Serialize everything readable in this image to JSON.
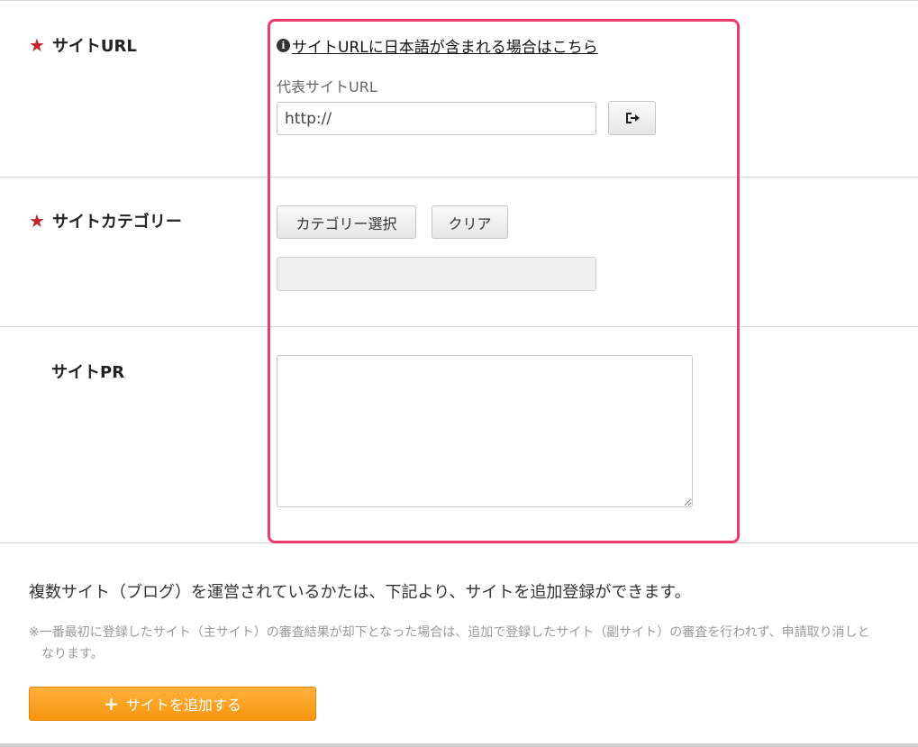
{
  "site_url": {
    "label": "サイトURL",
    "help_link": "サイトURLに日本語が含まれる場合はこちら",
    "field_label": "代表サイトURL",
    "value": "http://"
  },
  "site_category": {
    "label": "サイトカテゴリー",
    "select_button": "カテゴリー選択",
    "clear_button": "クリア"
  },
  "site_pr": {
    "label": "サイトPR"
  },
  "multi_site": {
    "text": "複数サイト（ブログ）を運営されているかたは、下記より、サイトを追加登録ができます。",
    "note": "※一番最初に登録したサイト（主サイト）の審査結果が却下となった場合は、追加で登録したサイト（副サイト）の審査を行われず、申請取り消しとなります。",
    "add_button": "サイトを追加する"
  },
  "icons": {
    "required": "star-icon",
    "info": "info-icon",
    "open": "open-url-icon",
    "add": "plus-icon"
  },
  "colors": {
    "star": "#c0262c",
    "highlight": "#ee3a6d",
    "add_button": "#f7950f"
  }
}
